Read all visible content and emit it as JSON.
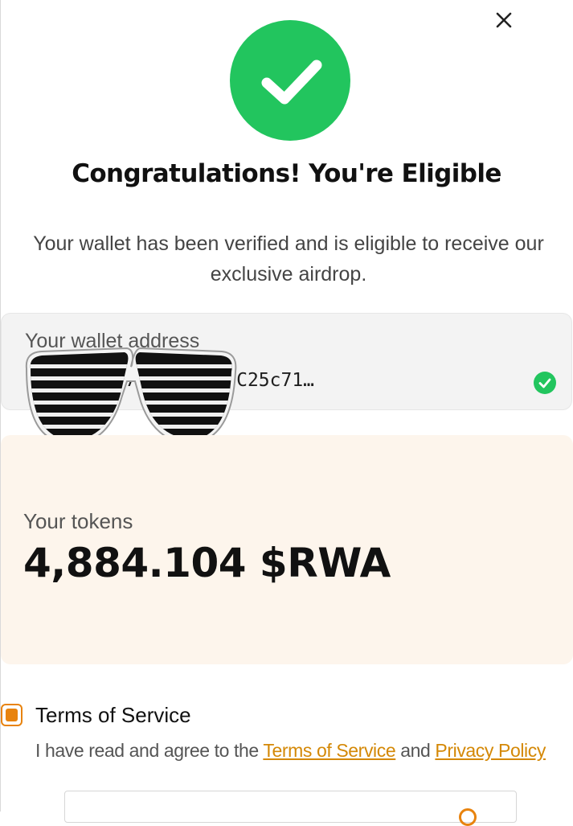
{
  "dialog": {
    "title": "Congratulations! You're Eligible",
    "subtitle": "Your wallet has been verified and is eligible to receive our exclusive airdrop."
  },
  "wallet": {
    "label": "Your wallet address",
    "address_visible": "C                    f5fc394725d96280FC25c71…"
  },
  "tokens": {
    "label": "Your tokens",
    "amount": "4,884.104 $RWA"
  },
  "terms": {
    "title": "Terms of Service",
    "checked": true,
    "agree_prefix": "I have read and agree to the ",
    "tos_link": "Terms of Service",
    "conjunction": " and ",
    "privacy_link": "Privacy Policy"
  },
  "icons": {
    "close": "close-icon",
    "success": "check-circle-icon",
    "verified": "verified-check-icon",
    "overlay": "shutter-shades-sticker"
  },
  "colors": {
    "success_green": "#22c55e",
    "accent_orange": "#e8830e",
    "link_gold": "#d48806",
    "tokens_card_bg": "#fdf5ec",
    "wallet_card_bg": "#f3f3f3"
  }
}
